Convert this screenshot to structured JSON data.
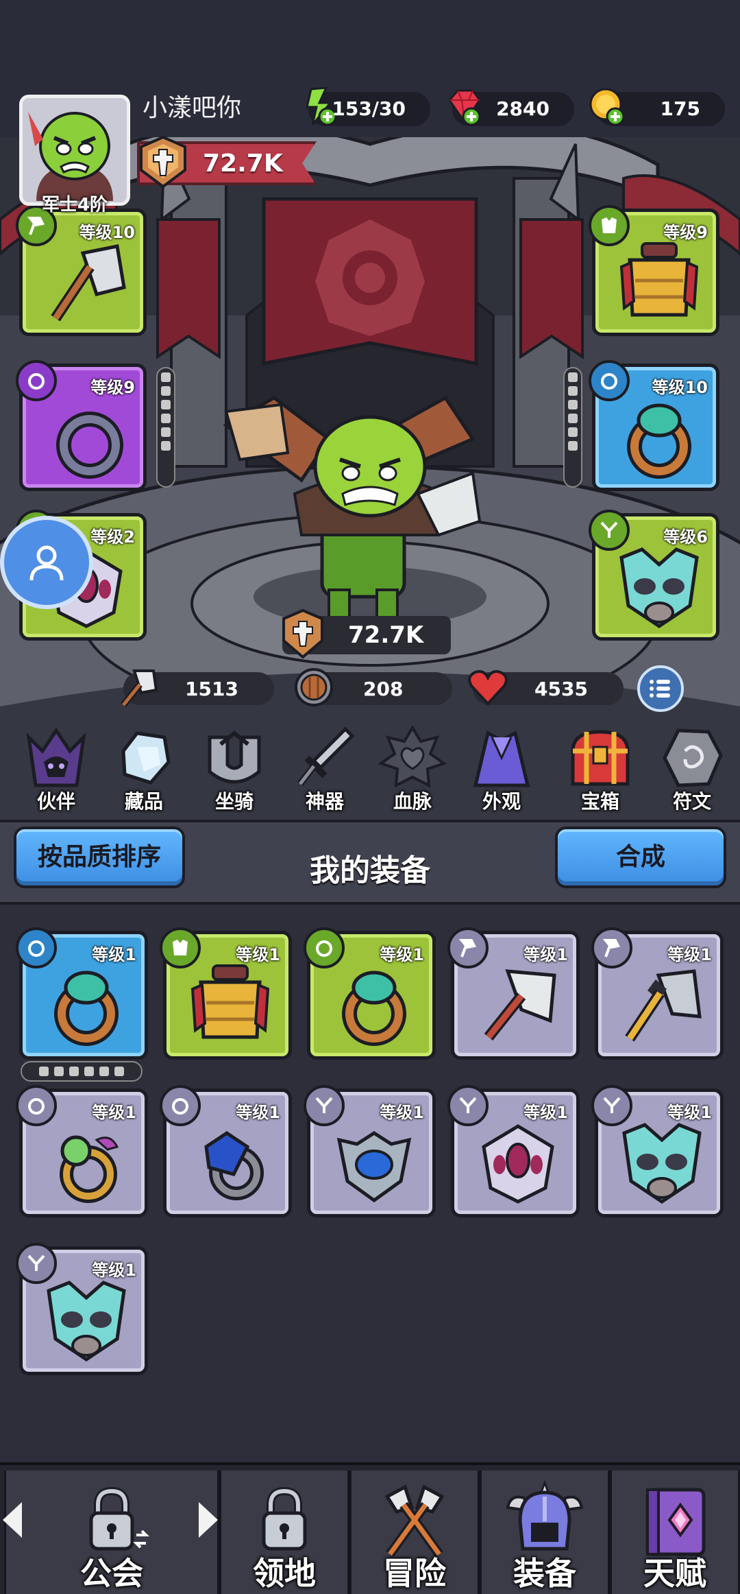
{
  "player": {
    "name": "小漾吧你",
    "rank": "军士4阶",
    "power": "72.7K"
  },
  "resources": {
    "energy": "153/30",
    "gems": "2840",
    "gold": "175"
  },
  "equipped": {
    "weapon": {
      "level": "等级10",
      "quality": "green"
    },
    "ring": {
      "level": "等级9",
      "quality": "purple"
    },
    "helmet": {
      "level": "等级2",
      "quality": "green"
    },
    "armor": {
      "level": "等级9",
      "quality": "green"
    },
    "ring2": {
      "level": "等级10",
      "quality": "blue"
    },
    "mask": {
      "level": "等级6",
      "quality": "green"
    }
  },
  "hero": {
    "power": "72.7K",
    "attack": "1513",
    "defense": "208",
    "health": "4535"
  },
  "features": [
    {
      "label": "伙伴",
      "icon": "hooded-companion-icon"
    },
    {
      "label": "藏品",
      "icon": "crystal-collection-icon"
    },
    {
      "label": "坐骑",
      "icon": "mount-horns-icon"
    },
    {
      "label": "神器",
      "icon": "artifact-sword-icon"
    },
    {
      "label": "血脉",
      "icon": "bloodline-emblem-icon"
    },
    {
      "label": "外观",
      "icon": "cape-appearance-icon"
    },
    {
      "label": "宝箱",
      "icon": "treasure-chest-icon"
    },
    {
      "label": "符文",
      "icon": "rune-stone-icon"
    }
  ],
  "equipment_section": {
    "sort_label": "按品质排序",
    "title": "我的装备",
    "merge_label": "合成"
  },
  "inventory": [
    {
      "level": "等级1",
      "quality": "blue",
      "type": "ring"
    },
    {
      "level": "等级1",
      "quality": "green",
      "type": "armor"
    },
    {
      "level": "等级1",
      "quality": "green",
      "type": "ring"
    },
    {
      "level": "等级1",
      "quality": "gray",
      "type": "weapon"
    },
    {
      "level": "等级1",
      "quality": "gray",
      "type": "weapon"
    },
    {
      "level": "等级1",
      "quality": "gray",
      "type": "ring"
    },
    {
      "level": "等级1",
      "quality": "gray",
      "type": "ring"
    },
    {
      "level": "等级1",
      "quality": "gray",
      "type": "amulet"
    },
    {
      "level": "等级1",
      "quality": "gray",
      "type": "amulet"
    },
    {
      "level": "等级1",
      "quality": "gray",
      "type": "amulet"
    },
    {
      "level": "等级1",
      "quality": "gray",
      "type": "amulet"
    }
  ],
  "nav": {
    "guild": "公会",
    "territory": "领地",
    "adventure": "冒险",
    "equipment": "装备",
    "talent": "天赋"
  },
  "colors": {
    "green_quality": "#9dc33a",
    "blue_quality": "#3fa2e0",
    "purple_quality": "#a24ad8",
    "gray_quality": "#a6a2c4",
    "button_blue": "#4a9df0"
  }
}
